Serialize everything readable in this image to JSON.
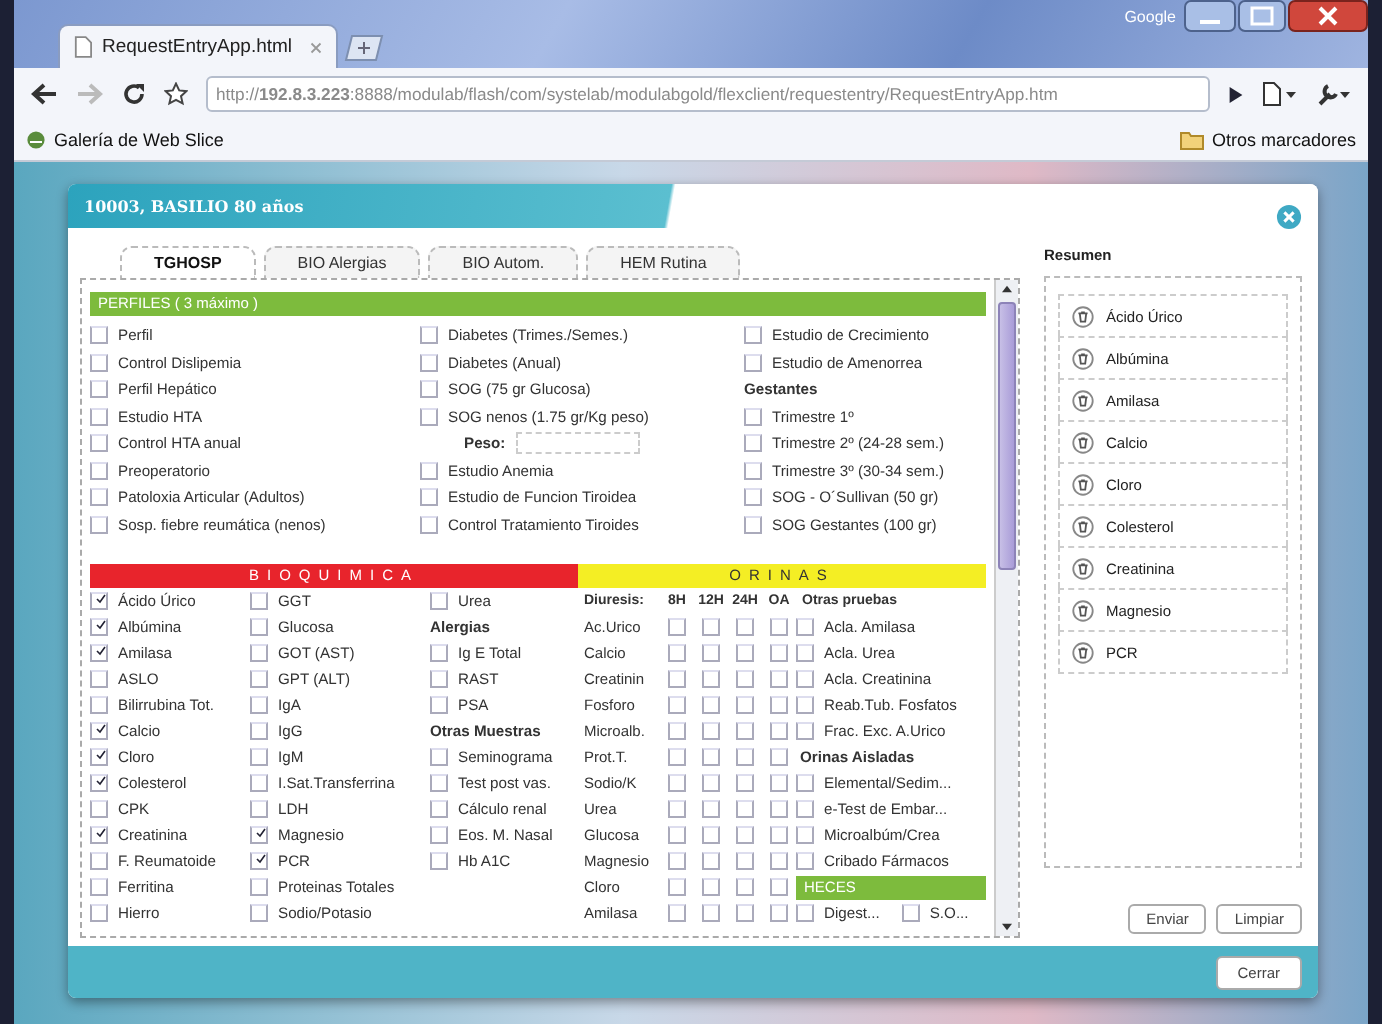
{
  "browser": {
    "tab_title": "RequestEntryApp.html",
    "corner_label": "Google",
    "url": "http://**192.8.3.223**:8888/modulab/flash/com/systelab/modulabgold/flexclient/requestentry/RequestEntryApp.htm",
    "bookmark": "Galería de Web Slice",
    "other_bookmarks": "Otros marcadores"
  },
  "dialog": {
    "title": "10003, BASILIO 80 años",
    "tabs": [
      {
        "label": "TGHOSP",
        "selected": true
      },
      {
        "label": "BIO Alergias",
        "selected": false
      },
      {
        "label": "BIO Autom.",
        "selected": false
      },
      {
        "label": "HEM Rutina",
        "selected": false
      }
    ],
    "perfiles": {
      "title": "PERFILES ( 3 máximo )",
      "columns": [
        [
          {
            "kind": "check",
            "label": "Perfil",
            "checked": false
          },
          {
            "kind": "check",
            "label": "Control Dislipemia",
            "checked": false
          },
          {
            "kind": "check",
            "label": "Perfil Hepático",
            "checked": false
          },
          {
            "kind": "check",
            "label": "Estudio HTA",
            "checked": false
          },
          {
            "kind": "check",
            "label": "Control HTA anual",
            "checked": false
          },
          {
            "kind": "check",
            "label": "Preoperatorio",
            "checked": false
          },
          {
            "kind": "check",
            "label": "Patoloxia Articular (Adultos)",
            "checked": false
          },
          {
            "kind": "check",
            "label": "Sosp. fiebre reumática (nenos)",
            "checked": false
          }
        ],
        [
          {
            "kind": "check",
            "label": "Diabetes (Trimes./Semes.)",
            "checked": false
          },
          {
            "kind": "check",
            "label": "Diabetes (Anual)",
            "checked": false
          },
          {
            "kind": "check",
            "label": "SOG (75 gr Glucosa)",
            "checked": false
          },
          {
            "kind": "check",
            "label": "SOG nenos (1.75 gr/Kg peso)",
            "checked": false
          },
          {
            "kind": "field",
            "label": "Peso:"
          },
          {
            "kind": "check",
            "label": "Estudio Anemia",
            "checked": false
          },
          {
            "kind": "check",
            "label": "Estudio de Funcion Tiroidea",
            "checked": false
          },
          {
            "kind": "check",
            "label": "Control Tratamiento Tiroides",
            "checked": false
          }
        ],
        [
          {
            "kind": "check",
            "label": "Estudio de Crecimiento",
            "checked": false
          },
          {
            "kind": "check",
            "label": "Estudio de Amenorrea",
            "checked": false
          },
          {
            "kind": "heading",
            "label": "Gestantes"
          },
          {
            "kind": "check",
            "label": "Trimestre 1º",
            "checked": false
          },
          {
            "kind": "check",
            "label": "Trimestre 2º (24-28 sem.)",
            "checked": false
          },
          {
            "kind": "check",
            "label": "Trimestre 3º (30-34 sem.)",
            "checked": false
          },
          {
            "kind": "check",
            "label": "SOG - O´Sullivan (50 gr)",
            "checked": false
          },
          {
            "kind": "check",
            "label": "SOG Gestantes (100 gr)",
            "checked": false
          }
        ]
      ]
    },
    "bioquimica": {
      "title": "BIOQUIMICA",
      "columns": [
        [
          {
            "kind": "check",
            "label": "Ácido Úrico",
            "checked": true
          },
          {
            "kind": "check",
            "label": "Albúmina",
            "checked": true
          },
          {
            "kind": "check",
            "label": "Amilasa",
            "checked": true
          },
          {
            "kind": "check",
            "label": "ASLO",
            "checked": false
          },
          {
            "kind": "check",
            "label": "Bilirrubina Tot.",
            "checked": false
          },
          {
            "kind": "check",
            "label": "Calcio",
            "checked": true
          },
          {
            "kind": "check",
            "label": "Cloro",
            "checked": true
          },
          {
            "kind": "check",
            "label": "Colesterol",
            "checked": true
          },
          {
            "kind": "check",
            "label": "CPK",
            "checked": false
          },
          {
            "kind": "check",
            "label": "Creatinina",
            "checked": true
          },
          {
            "kind": "check",
            "label": "F. Reumatoide",
            "checked": false
          },
          {
            "kind": "check",
            "label": "Ferritina",
            "checked": false
          },
          {
            "kind": "check",
            "label": "Hierro",
            "checked": false
          }
        ],
        [
          {
            "kind": "check",
            "label": "GGT",
            "checked": false
          },
          {
            "kind": "check",
            "label": "Glucosa",
            "checked": false
          },
          {
            "kind": "check",
            "label": "GOT (AST)",
            "checked": false
          },
          {
            "kind": "check",
            "label": "GPT (ALT)",
            "checked": false
          },
          {
            "kind": "check",
            "label": "IgA",
            "checked": false
          },
          {
            "kind": "check",
            "label": "IgG",
            "checked": false
          },
          {
            "kind": "check",
            "label": "IgM",
            "checked": false
          },
          {
            "kind": "check",
            "label": "I.Sat.Transferrina",
            "checked": false
          },
          {
            "kind": "check",
            "label": "LDH",
            "checked": false
          },
          {
            "kind": "check",
            "label": "Magnesio",
            "checked": true
          },
          {
            "kind": "check",
            "label": "PCR",
            "checked": true
          },
          {
            "kind": "check",
            "label": "Proteinas Totales",
            "checked": false
          },
          {
            "kind": "check",
            "label": "Sodio/Potasio",
            "checked": false
          }
        ],
        [
          {
            "kind": "check",
            "label": "Urea",
            "checked": false
          },
          {
            "kind": "heading",
            "label": "Alergias"
          },
          {
            "kind": "check",
            "label": "Ig E Total",
            "checked": false
          },
          {
            "kind": "check",
            "label": "RAST",
            "checked": false
          },
          {
            "kind": "check",
            "label": "PSA",
            "checked": false
          },
          {
            "kind": "heading",
            "label": "Otras Muestras"
          },
          {
            "kind": "check",
            "label": "Seminograma",
            "checked": false
          },
          {
            "kind": "check",
            "label": "Test post vas.",
            "checked": false
          },
          {
            "kind": "check",
            "label": "Cálculo renal",
            "checked": false
          },
          {
            "kind": "check",
            "label": "Eos. M. Nasal",
            "checked": false
          },
          {
            "kind": "check",
            "label": "Hb A1C",
            "checked": false
          }
        ]
      ]
    },
    "orinas": {
      "title": "ORINAS",
      "header": [
        "Diuresis:",
        "8H",
        "12H",
        "24H",
        "OA",
        "Otras pruebas"
      ],
      "rows": [
        {
          "label": "Ac.Urico",
          "checks": [
            false,
            false,
            false,
            false
          ]
        },
        {
          "label": "Calcio",
          "checks": [
            false,
            false,
            false,
            false
          ]
        },
        {
          "label": "Creatinin",
          "checks": [
            false,
            false,
            false,
            false
          ]
        },
        {
          "label": "Fosforo",
          "checks": [
            false,
            false,
            false,
            false
          ]
        },
        {
          "label": "Microalb.",
          "checks": [
            false,
            false,
            false,
            false
          ]
        },
        {
          "label": "Prot.T.",
          "checks": [
            false,
            false,
            false,
            false
          ]
        },
        {
          "label": "Sodio/K",
          "checks": [
            false,
            false,
            false,
            false
          ]
        },
        {
          "label": "Urea",
          "checks": [
            false,
            false,
            false,
            false
          ]
        },
        {
          "label": "Glucosa",
          "checks": [
            false,
            false,
            false,
            false
          ]
        },
        {
          "label": "Magnesio",
          "checks": [
            false,
            false,
            false,
            false
          ]
        },
        {
          "label": "Cloro",
          "checks": [
            false,
            false,
            false,
            false
          ]
        },
        {
          "label": "Amilasa",
          "checks": [
            false,
            false,
            false,
            false
          ]
        }
      ],
      "side": [
        {
          "kind": "check",
          "label": "Acla. Amilasa",
          "checked": false
        },
        {
          "kind": "check",
          "label": "Acla. Urea",
          "checked": false
        },
        {
          "kind": "check",
          "label": "Acla. Creatinina",
          "checked": false
        },
        {
          "kind": "check",
          "label": "Reab.Tub. Fosfatos",
          "checked": false
        },
        {
          "kind": "check",
          "label": "Frac. Exc. A.Urico",
          "checked": false
        },
        {
          "kind": "heading",
          "label": "Orinas Aisladas"
        },
        {
          "kind": "check",
          "label": "Elemental/Sedim...",
          "checked": false
        },
        {
          "kind": "check",
          "label": "e-Test de Embar...",
          "checked": false
        },
        {
          "kind": "check",
          "label": "Microalbúm/Crea",
          "checked": false
        },
        {
          "kind": "check",
          "label": "Cribado Fármacos",
          "checked": false
        },
        {
          "kind": "section",
          "label": "HECES"
        },
        {
          "kind": "pair",
          "items": [
            {
              "label": "Digest...",
              "checked": false
            },
            {
              "label": "S.O...",
              "checked": false
            }
          ]
        }
      ]
    },
    "summary": {
      "title": "Resumen",
      "items": [
        "Ácido Úrico",
        "Albúmina",
        "Amilasa",
        "Calcio",
        "Cloro",
        "Colesterol",
        "Creatinina",
        "Magnesio",
        "PCR"
      ]
    },
    "buttons": [
      "Enviar",
      "Limpiar"
    ],
    "close_button": "Cerrar"
  }
}
